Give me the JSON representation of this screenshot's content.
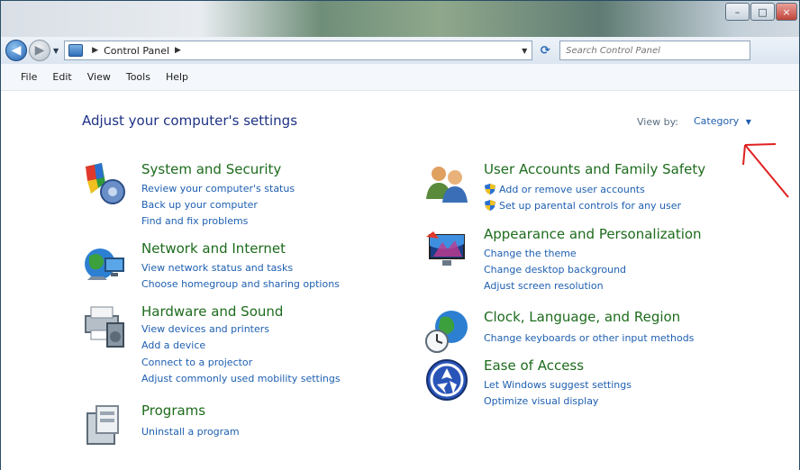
{
  "window": {
    "controls": {
      "minimize": "–",
      "maximize": "□",
      "close": "×"
    }
  },
  "nav": {
    "back_icon": "back-arrow-icon",
    "forward_icon": "forward-arrow-icon",
    "breadcrumb": [
      "Control Panel"
    ],
    "search_placeholder": "Search Control Panel"
  },
  "menu": [
    "File",
    "Edit",
    "View",
    "Tools",
    "Help"
  ],
  "main": {
    "title": "Adjust your computer's settings",
    "view_by_label": "View by:",
    "view_by_value": "Category"
  },
  "categories": [
    {
      "title": "System and Security",
      "icon": "system-security-icon",
      "links": [
        "Review your computer's status",
        "Back up your computer",
        "Find and fix problems"
      ]
    },
    {
      "title": "Network and Internet",
      "icon": "network-internet-icon",
      "links": [
        "View network status and tasks",
        "Choose homegroup and sharing options"
      ]
    },
    {
      "title": "Hardware and Sound",
      "icon": "hardware-sound-icon",
      "links": [
        "View devices and printers",
        "Add a device",
        "Connect to a projector",
        "Adjust commonly used mobility settings"
      ]
    },
    {
      "title": "Programs",
      "icon": "programs-icon",
      "links": [
        "Uninstall a program"
      ]
    },
    {
      "title": "User Accounts and Family Safety",
      "icon": "user-accounts-icon",
      "links": [
        "Add or remove user accounts",
        "Set up parental controls for any user"
      ]
    },
    {
      "title": "Appearance and Personalization",
      "icon": "appearance-icon",
      "links": [
        "Change the theme",
        "Change desktop background",
        "Adjust screen resolution"
      ]
    },
    {
      "title": "Clock, Language, and Region",
      "icon": "clock-globe-icon",
      "links": [
        "Change keyboards or other input methods"
      ]
    },
    {
      "title": "Ease of Access",
      "icon": "ease-of-access-icon",
      "links": [
        "Let Windows suggest settings",
        "Optimize visual display"
      ]
    }
  ],
  "colors": {
    "title_blue": "#1e3287",
    "category_green": "#1d6b1d",
    "link_blue": "#1e5fb0",
    "annotation_red": "#e02020"
  }
}
